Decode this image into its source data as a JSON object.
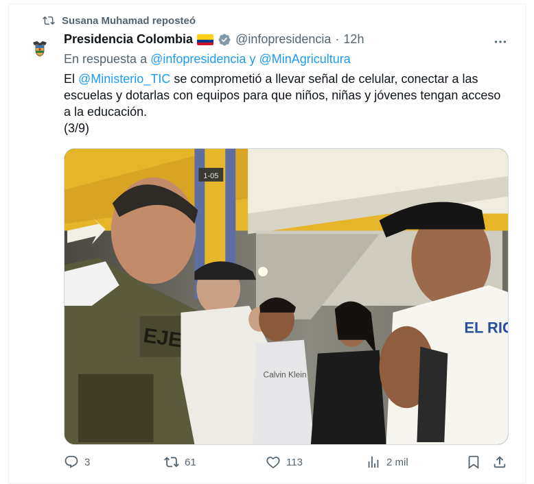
{
  "repost": {
    "text": "Susana Muhamad reposteó"
  },
  "tweet": {
    "display_name": "Presidencia Colombia",
    "handle": "@infopresidencia",
    "separator": "·",
    "time": "12h",
    "reply_prefix": "En respuesta a ",
    "reply_mentions": "@infopresidencia y @MinAgricultura",
    "body_before": "El ",
    "body_mention": "@Ministerio_TIC",
    "body_after": " se comprometió a llevar señal de celular, conectar a las escuelas y dotarlas con equipos para que niños, niñas y jóvenes tengan acceso a la educación.",
    "thread_counter": "(3/9)",
    "vest_text": "EJERC",
    "shirt_text": "Calvin Klein",
    "towel_text": "EL RIC",
    "sign_text": "1-05"
  },
  "actions": {
    "replies": "3",
    "reposts": "61",
    "likes": "113",
    "views": "2 mil"
  },
  "colors": {
    "link": "#1d9bf0",
    "muted": "#536471",
    "text": "#0f1419",
    "border": "#eff3f4"
  },
  "icons": {
    "repost": "repost-icon",
    "verified": "verified-badge-icon",
    "more": "more-options-icon",
    "reply": "reply-icon",
    "like": "heart-icon",
    "views": "views-bar-chart-icon",
    "bookmark": "bookmark-icon",
    "share": "share-icon"
  }
}
